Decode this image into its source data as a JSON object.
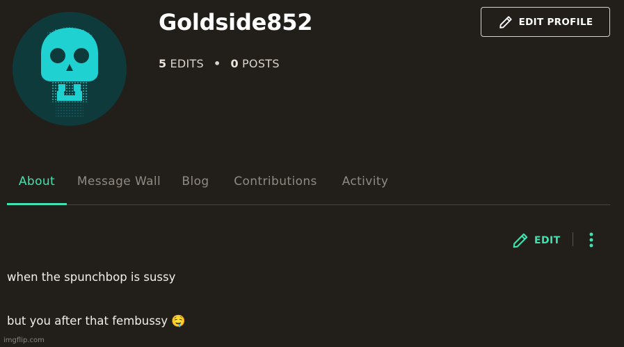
{
  "profile": {
    "username": "Goldside852",
    "avatar_icon": "skull-icon",
    "stats": {
      "edits_count": "5",
      "edits_label": "EDITS",
      "separator": "•",
      "posts_count": "0",
      "posts_label": "POSTS"
    },
    "edit_profile_label": "EDIT PROFILE"
  },
  "tabs": [
    {
      "label": "About",
      "active": true
    },
    {
      "label": "Message Wall",
      "active": false
    },
    {
      "label": "Blog",
      "active": false
    },
    {
      "label": "Contributions",
      "active": false
    },
    {
      "label": "Activity",
      "active": false
    }
  ],
  "about": {
    "edit_label": "EDIT",
    "bio": [
      "when the spunchbop is sussy",
      "but you after that fembussy 🤤"
    ]
  },
  "watermark": "imgflip.com",
  "colors": {
    "background": "#221f1a",
    "accent": "#3fe3b1",
    "avatar_bg": "#0f3a3b",
    "avatar_fg": "#1fd1d1",
    "muted_text": "#8f8b83"
  }
}
